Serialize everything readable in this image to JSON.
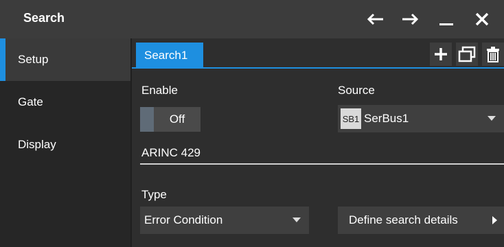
{
  "window": {
    "title": "Search"
  },
  "title_controls": [
    "back-arrow-icon",
    "forward-arrow-icon",
    "minimize-icon",
    "close-icon"
  ],
  "sidebar": {
    "items": [
      {
        "label": "Setup",
        "active": true
      },
      {
        "label": "Gate",
        "active": false
      },
      {
        "label": "Display",
        "active": false
      }
    ]
  },
  "tabs": [
    {
      "label": "Search1",
      "active": true
    }
  ],
  "tab_tools": [
    "plus-icon",
    "copy-window-icon",
    "trash-icon"
  ],
  "form": {
    "enable": {
      "label": "Enable",
      "value": "Off"
    },
    "source": {
      "label": "Source",
      "badge": "SB1",
      "value": "SerBus1"
    },
    "section_title": "ARINC 429",
    "type": {
      "label": "Type",
      "value": "Error Condition"
    },
    "define_button": "Define search details"
  },
  "colors": {
    "accent": "#1e8fe0",
    "background": "#2e2e2e",
    "titlebar": "#3c3c3c"
  }
}
